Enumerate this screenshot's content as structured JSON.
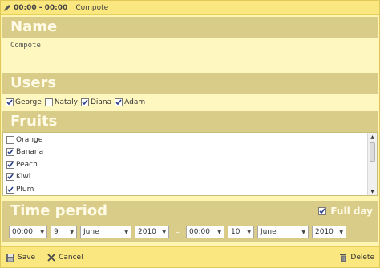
{
  "titlebar": {
    "icon": "pencil-icon",
    "time": "00:00 - 00:00",
    "event_text": "Compote"
  },
  "name_section": {
    "title": "Name",
    "value": "Compote"
  },
  "users_section": {
    "title": "Users",
    "users": [
      {
        "label": "George",
        "checked": true
      },
      {
        "label": "Nataly",
        "checked": false
      },
      {
        "label": "Diana",
        "checked": true
      },
      {
        "label": "Adam",
        "checked": true
      }
    ]
  },
  "fruits_section": {
    "title": "Fruits",
    "items": [
      {
        "label": "Orange",
        "checked": false
      },
      {
        "label": "Banana",
        "checked": true
      },
      {
        "label": "Peach",
        "checked": true
      },
      {
        "label": "Kiwi",
        "checked": true
      },
      {
        "label": "Plum",
        "checked": true
      }
    ]
  },
  "time_section": {
    "title": "Time period",
    "full_day_label": "Full day",
    "full_day_checked": true,
    "start": {
      "time": "00:00",
      "day": "9",
      "month": "June",
      "year": "2010"
    },
    "separator": "–",
    "end": {
      "time": "00:00",
      "day": "10",
      "month": "June",
      "year": "2010"
    }
  },
  "actions": {
    "save_label": "Save",
    "cancel_label": "Cancel",
    "delete_label": "Delete"
  },
  "colors": {
    "background": "#fff5b3",
    "header_band": "#d9cc88",
    "bar": "#fbe77f"
  }
}
